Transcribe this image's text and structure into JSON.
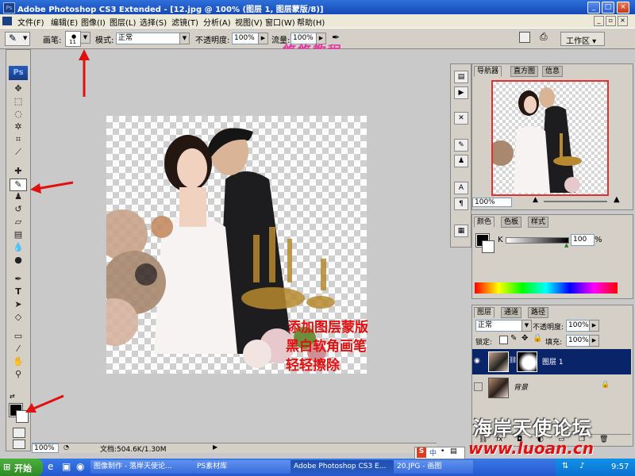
{
  "window": {
    "title": "Adobe Photoshop CS3 Extended - [12.jpg @ 100% (图层 1, 图层蒙版/8)]"
  },
  "menu": [
    "文件(F)",
    "编辑(E)",
    "图像(I)",
    "图层(L)",
    "选择(S)",
    "滤镜(T)",
    "分析(A)",
    "视图(V)",
    "窗口(W)",
    "帮助(H)"
  ],
  "options": {
    "brush_label": "画笔:",
    "brush_size": "11",
    "mode_label": "模式:",
    "mode_value": "正常",
    "opacity_label": "不透明度:",
    "opacity_value": "100%",
    "flow_label": "流量:",
    "flow_value": "100%",
    "workspace_label": "工作区 ▾"
  },
  "toolbox": {
    "logo": "Ps"
  },
  "canvas": {
    "zoom": "100%",
    "doc_info": "文档:504.6K/1.30M"
  },
  "navigator": {
    "tabs": [
      "导航器",
      "直方图",
      "信息"
    ],
    "zoom": "100%"
  },
  "color_panel": {
    "tabs": [
      "颜色",
      "色板",
      "样式"
    ],
    "channel_label": "K",
    "value": "100",
    "unit": "%"
  },
  "layers_panel": {
    "tabs": [
      "图层",
      "通道",
      "路径"
    ],
    "blend_mode": "正常",
    "opacity_label": "不透明度:",
    "opacity_value": "100%",
    "lock_label": "锁定:",
    "fill_label": "填充:",
    "fill_value": "100%",
    "layers": [
      {
        "name": "图层 1",
        "selected": true
      },
      {
        "name": "背景",
        "selected": false
      }
    ]
  },
  "annotations": {
    "watermark_top": "悠悠教程",
    "instruction_line1": "添加图层蒙版",
    "instruction_line2": "黑白软角画笔",
    "instruction_line3": "轻轻擦除",
    "site_title": "海岸天使论坛",
    "site_url": "www.luoan.cn"
  },
  "taskbar": {
    "start": "开始",
    "tasks": [
      "图像制作 - 落岸天使论...",
      "PS素材库",
      "Adobe Photoshop CS3 E...",
      "20.JPG - 画图"
    ],
    "clock": "9:57"
  }
}
